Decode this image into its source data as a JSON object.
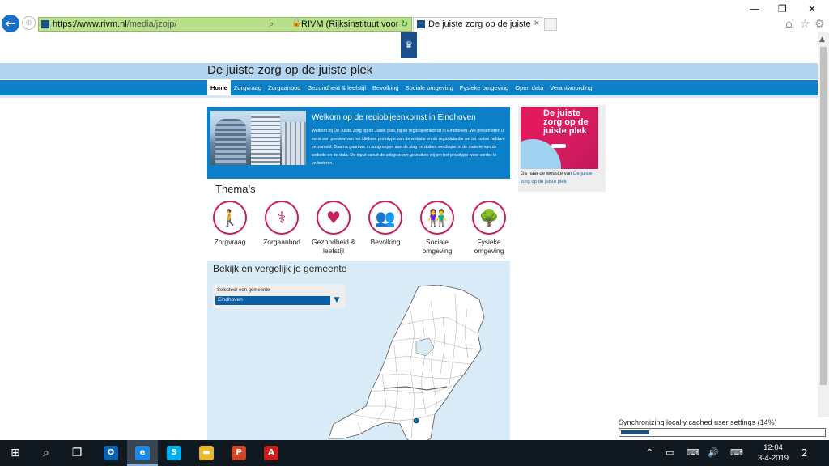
{
  "browser": {
    "url_main": "https://www.rivm.nl",
    "url_path": "/media/jzojp/",
    "site_identity": "RIVM (Rijksinstituut voor V...",
    "tab_title": "De juiste zorg op de juiste pl...",
    "back_glyph": "←",
    "forward_glyph": "⊕",
    "search_glyph": "⌕",
    "lock_glyph": "🔒",
    "reload_glyph": "↻",
    "tab_close": "×",
    "minimize": "—",
    "restore": "❐",
    "close": "✕",
    "home_glyph": "⌂",
    "star_glyph": "☆",
    "gear_glyph": "⚙"
  },
  "site": {
    "logo_glyph": "♛",
    "title": "De juiste zorg op de juiste plek",
    "nav": [
      "Home",
      "Zorgvraag",
      "Zorgaanbod",
      "Gezondheid & leefstijl",
      "Bevolking",
      "Sociale omgeving",
      "Fysieke omgeving",
      "Open data",
      "Verantwoording"
    ]
  },
  "hero": {
    "heading": "Welkom op de regiobijeenkomst in Eindhoven",
    "body": "Welkom bij De Juiste Zorg op de Juiste plek, bij de regiobijeenkomst in Eindhoven. We presenteren u eerst een preview van het klikbare prototype van de website en de regiodata die we tot nu toe hebben verzameld. Daarna gaan we in subgroepen aan de slag en duiken we dieper in de materie van de website en de data. De input vanuit de subgroepen gebruiken wij om het prototype weer verder te verbeteren."
  },
  "sidebar": {
    "promo_text": "De juiste zorg op de juiste plek",
    "caption": "Ga naar de website van ",
    "link": "De juiste zorg op de juiste plek"
  },
  "themes": {
    "title": "Thema’s",
    "items": [
      {
        "label": "Zorgvraag",
        "icon": "person-with-walker-icon",
        "glyph": "🚶"
      },
      {
        "label": "Zorgaanbod",
        "icon": "doctor-icon",
        "glyph": "⚕"
      },
      {
        "label": "Gezondheid & leefstijl",
        "icon": "heart-check-icon",
        "glyph": "♥"
      },
      {
        "label": "Bevolking",
        "icon": "group-icon",
        "glyph": "👥"
      },
      {
        "label": "Sociale omgeving",
        "icon": "couple-icon",
        "glyph": "👫"
      },
      {
        "label": "Fysieke omgeving",
        "icon": "tree-bench-icon",
        "glyph": "🌳"
      }
    ]
  },
  "compare": {
    "title": "Bekijk en vergelijk je gemeente",
    "select_label": "Selecteer een gemeente",
    "selected": "Eindhoven",
    "arrow": "▼"
  },
  "sync": {
    "text": "Synchronizing locally cached user settings (14%)",
    "progress": 0.14
  },
  "taskbar": {
    "start": "⊞",
    "search": "⌕",
    "taskview": "❐",
    "apps": [
      {
        "name": "outlook",
        "glyph": "O",
        "color": "#0a64b4"
      },
      {
        "name": "internet-explorer",
        "glyph": "e",
        "color": "#1e88e5",
        "active": true
      },
      {
        "name": "skype",
        "glyph": "S",
        "color": "#00aff0"
      },
      {
        "name": "file-explorer",
        "glyph": "▬",
        "color": "#e8b730"
      },
      {
        "name": "powerpoint",
        "glyph": "P",
        "color": "#d04526"
      },
      {
        "name": "acrobat",
        "glyph": "A",
        "color": "#c81e1e"
      }
    ],
    "tray": [
      "^",
      "▭",
      "⌨",
      "🔊",
      "⌨"
    ],
    "time": "12:04",
    "date": "3-4-2019",
    "notifications": "2"
  },
  "colors": {
    "brand_blue": "#0b7fc7",
    "theme_pink": "#c8205e",
    "title_band": "#b3d4ee"
  }
}
